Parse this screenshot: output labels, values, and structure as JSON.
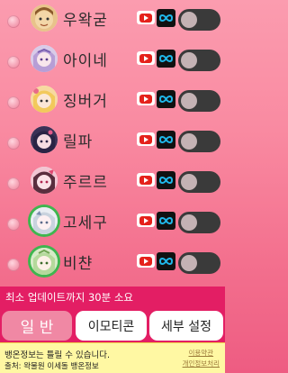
{
  "streamers": [
    {
      "name": "우왁굳",
      "avatar_icon": "woowakgood-avatar-icon",
      "online": false
    },
    {
      "name": "아이네",
      "avatar_icon": "ine-avatar-icon",
      "online": false
    },
    {
      "name": "징버거",
      "avatar_icon": "jingburger-avatar-icon",
      "online": false
    },
    {
      "name": "릴파",
      "avatar_icon": "lilpa-avatar-icon",
      "online": false
    },
    {
      "name": "주르르",
      "avatar_icon": "jururu-avatar-icon",
      "online": false
    },
    {
      "name": "고세구",
      "avatar_icon": "gosegu-avatar-icon",
      "online": true
    },
    {
      "name": "비챤",
      "avatar_icon": "viichan-avatar-icon",
      "online": true
    }
  ],
  "row_icons": {
    "youtube": "youtube-icon",
    "link": "infinity-link-icon"
  },
  "status_text": "최소 업데이트까지 30분 소요",
  "tabs": [
    {
      "label": "일 반",
      "active": true
    },
    {
      "label": "이모티콘",
      "active": false
    },
    {
      "label": "세부 설정",
      "active": false
    }
  ],
  "footer": {
    "line1": "뱅온정보는 틀릴 수 있습니다.",
    "line2": "출처: 왁물원 이세돌 뱅온정보",
    "link1": "이용약관",
    "link2": "개인정보처리"
  },
  "colors": {
    "status_bar": "#e31e64",
    "active_tab": "#f088a4",
    "online_ring": "#3fb64f",
    "youtube_red": "#e5211b",
    "footer_bg": "#fff8a3"
  }
}
